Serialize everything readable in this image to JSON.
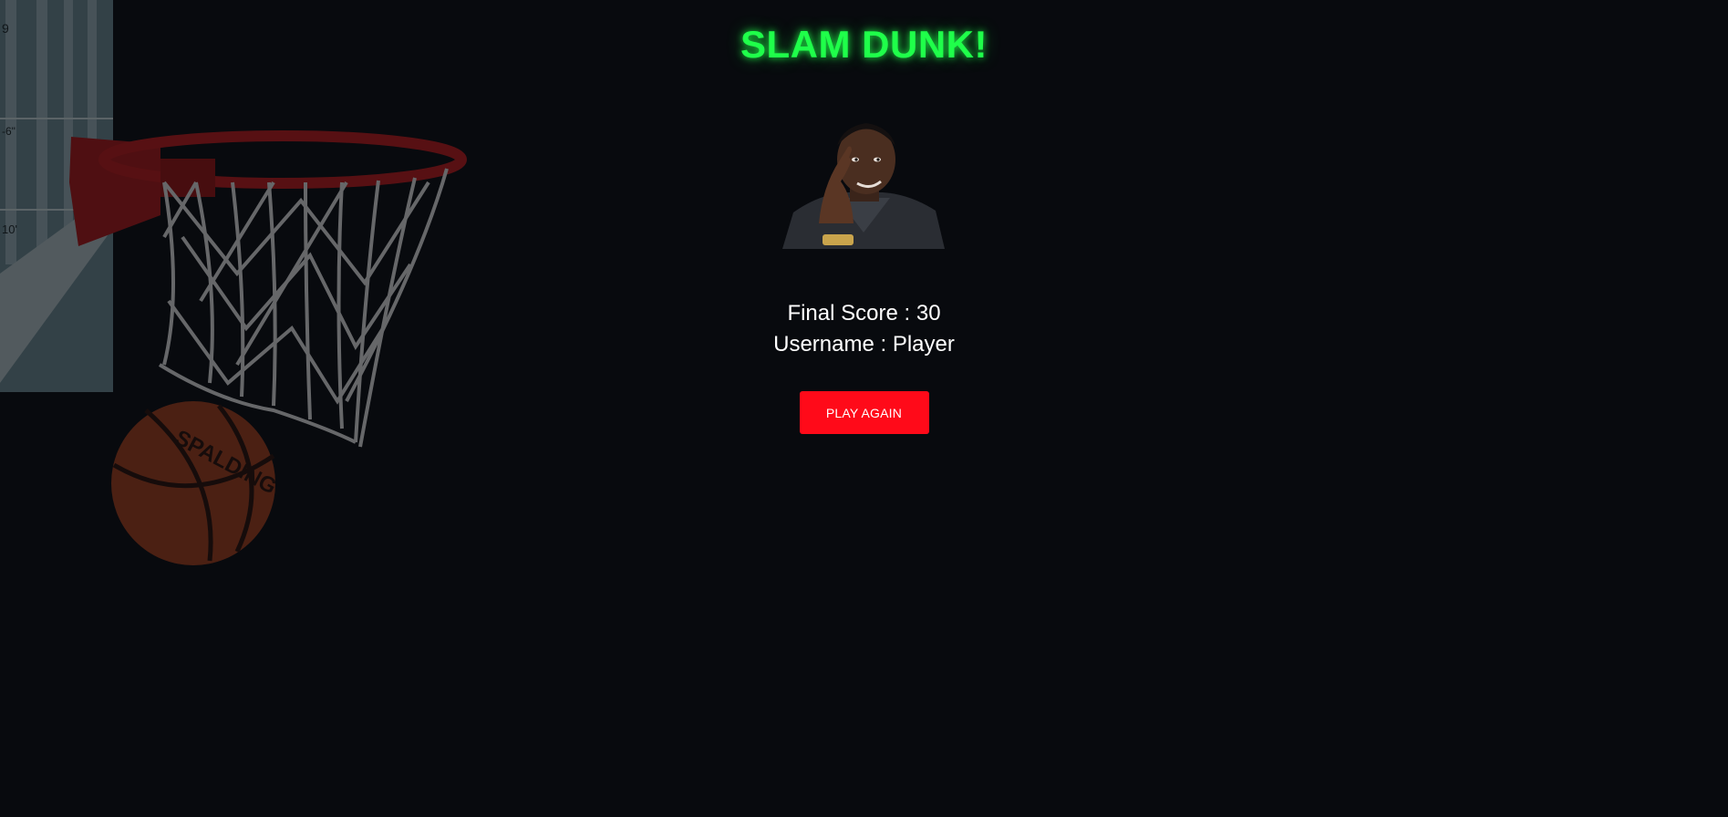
{
  "game": {
    "title": "SLAM DUNK!",
    "title_color": "#1fff4a",
    "background_color": "#080a0e"
  },
  "result": {
    "score_label": "Final Score",
    "score_value": "30",
    "username_label": "Username",
    "username_value": "Player",
    "separator": " : "
  },
  "actions": {
    "play_again_label": "PLAY AGAIN",
    "play_again_color": "#ff0a19"
  },
  "decor": {
    "backboard_marks": [
      "9",
      "-6\"",
      "10'"
    ],
    "ball_brand": "SPALDING",
    "hoop_icon": "basketball-hoop-icon",
    "avatar_icon": "thinking-man-avatar"
  }
}
